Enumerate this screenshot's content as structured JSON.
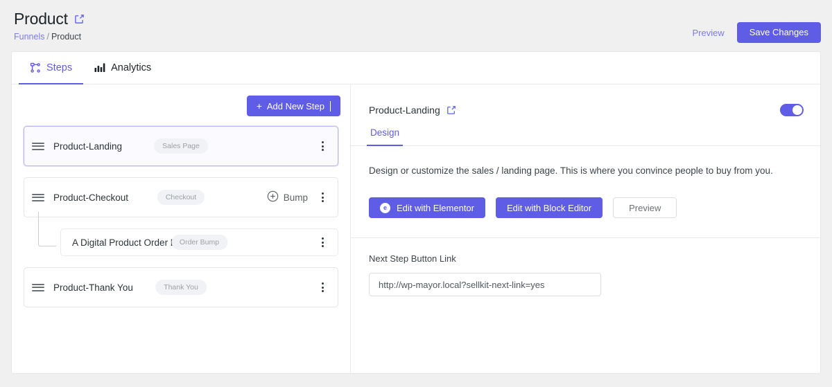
{
  "header": {
    "title": "Product",
    "title_edit_icon": "edit-square-icon",
    "breadcrumb": {
      "root": "Funnels",
      "separator": "/",
      "current": "Product"
    },
    "preview_link": "Preview",
    "save_button": "Save Changes"
  },
  "tabs": [
    {
      "label": "Steps",
      "icon": "flow-nodes-icon",
      "active": true
    },
    {
      "label": "Analytics",
      "icon": "bar-chart-icon",
      "active": false
    }
  ],
  "steps_panel": {
    "add_button": {
      "label": "Add New Step",
      "icon": "plus-icon"
    },
    "steps": [
      {
        "name": "Product-Landing",
        "badge": "Sales Page",
        "selected": true,
        "bump_action": null
      },
      {
        "name": "Product-Checkout",
        "badge": "Checkout",
        "selected": false,
        "bump_action": {
          "label": "Bump",
          "icon": "circle-plus-icon"
        }
      },
      {
        "name": "Product-Thank You",
        "badge": "Thank You",
        "selected": false,
        "bump_action": null
      }
    ],
    "order_bump": {
      "name": "A Digital Product Order Bump",
      "badge": "Order Bump"
    }
  },
  "detail_panel": {
    "title": "Product-Landing",
    "title_edit_icon": "edit-square-icon",
    "enabled_toggle": {
      "state": "on",
      "name": "step-enabled-toggle"
    },
    "tabs": [
      {
        "label": "Design",
        "active": true
      }
    ],
    "description": "Design or customize the sales / landing page. This is where you convince people to buy from you.",
    "actions": {
      "elementor": {
        "label": "Edit with Elementor",
        "icon": "elementor-logo-icon",
        "glyph": "e"
      },
      "block_editor": {
        "label": "Edit with Block Editor"
      },
      "preview": {
        "label": "Preview"
      }
    },
    "next_step_field": {
      "label": "Next Step Button Link",
      "value": "http://wp-mayor.local?sellkit-next-link=yes",
      "placeholder": "http://"
    }
  },
  "colors": {
    "accent": "#5f5ce6",
    "accent_light": "#7c7af0",
    "page_bg": "#f0f0f1",
    "badge_bg": "#f1f2f5",
    "badge_text": "#9ba0a6",
    "border": "#e9eaee"
  }
}
